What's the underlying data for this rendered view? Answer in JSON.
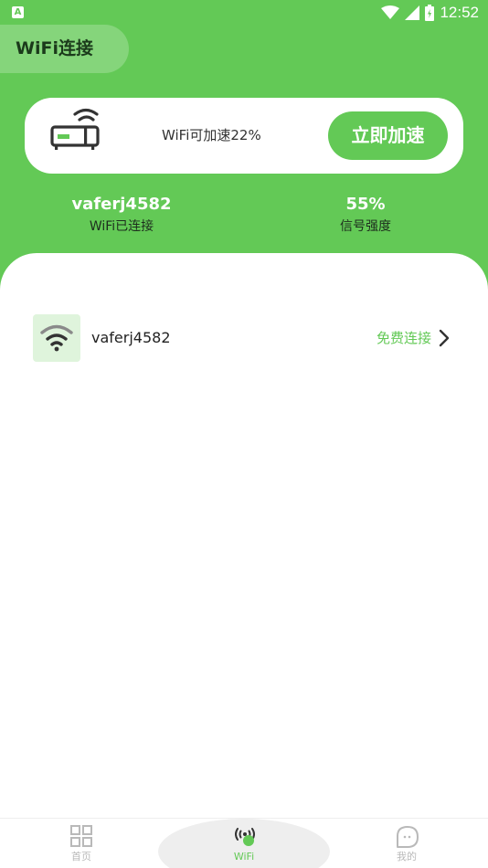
{
  "status_bar": {
    "notification_icon": "A",
    "time": "12:52",
    "icons": [
      "wifi-icon",
      "cell-signal-icon",
      "battery-icon"
    ]
  },
  "header": {
    "title": "WiFi连接"
  },
  "accel_card": {
    "router_icon": "router-icon",
    "message": "WiFi可加速22%",
    "button_label": "立即加速"
  },
  "stats": {
    "ssid": "vaferj4582",
    "ssid_label": "WiFi已连接",
    "signal": "55%",
    "signal_label": "信号强度"
  },
  "wifi_list": [
    {
      "icon": "wifi-icon",
      "name": "vaferj4582",
      "action": "免费连接"
    }
  ],
  "bottom_nav": [
    {
      "icon": "grid-icon",
      "label": "首页",
      "active": false
    },
    {
      "icon": "wifi-broadcast-icon",
      "label": "WiFi",
      "active": true
    },
    {
      "icon": "profile-icon",
      "label": "我的",
      "active": false
    }
  ],
  "colors": {
    "brand_green": "#63c956",
    "thumb_bg": "#dff4dc",
    "router_accent": "#63c956",
    "nav_inactive": "#b9b9b9"
  }
}
